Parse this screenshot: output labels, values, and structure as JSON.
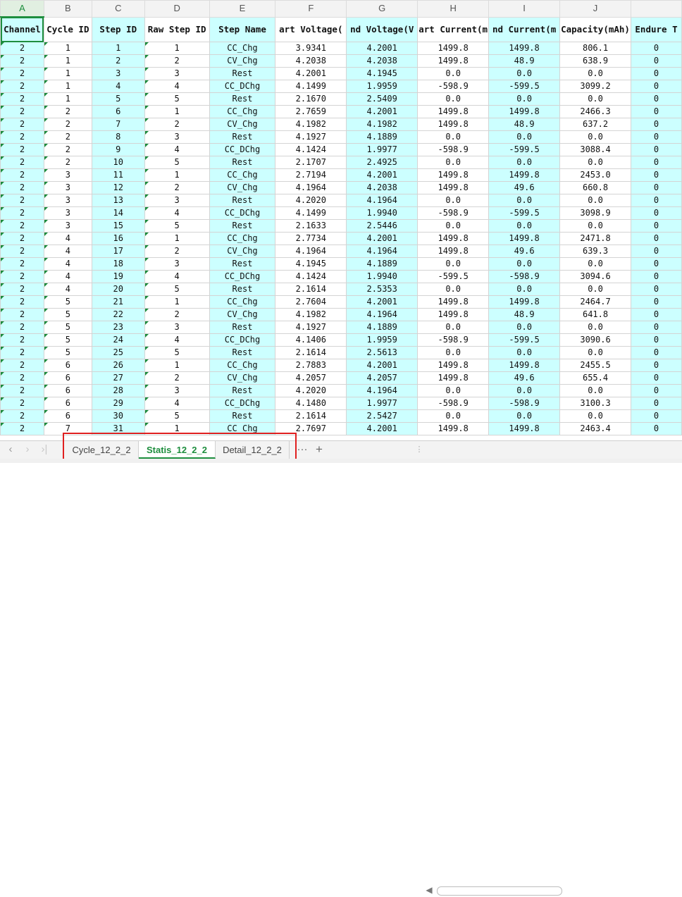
{
  "columns": [
    "A",
    "B",
    "C",
    "D",
    "E",
    "F",
    "G",
    "H",
    "I",
    "J",
    ""
  ],
  "headers": [
    "Channel",
    "Cycle ID",
    "Step ID",
    "Raw Step ID",
    "Step Name",
    "art Voltage(",
    "nd Voltage(V",
    "art Current(m",
    "nd Current(m",
    "Capacity(mAh)",
    "Endure T"
  ],
  "rows": [
    [
      "2",
      "1",
      "1",
      "1",
      "CC_Chg",
      "3.9341",
      "4.2001",
      "1499.8",
      "1499.8",
      "806.1",
      "0"
    ],
    [
      "2",
      "1",
      "2",
      "2",
      "CV_Chg",
      "4.2038",
      "4.2038",
      "1499.8",
      "48.9",
      "638.9",
      "0"
    ],
    [
      "2",
      "1",
      "3",
      "3",
      "Rest",
      "4.2001",
      "4.1945",
      "0.0",
      "0.0",
      "0.0",
      "0"
    ],
    [
      "2",
      "1",
      "4",
      "4",
      "CC_DChg",
      "4.1499",
      "1.9959",
      "-598.9",
      "-599.5",
      "3099.2",
      "0"
    ],
    [
      "2",
      "1",
      "5",
      "5",
      "Rest",
      "2.1670",
      "2.5409",
      "0.0",
      "0.0",
      "0.0",
      "0"
    ],
    [
      "2",
      "2",
      "6",
      "1",
      "CC_Chg",
      "2.7659",
      "4.2001",
      "1499.8",
      "1499.8",
      "2466.3",
      "0"
    ],
    [
      "2",
      "2",
      "7",
      "2",
      "CV_Chg",
      "4.1982",
      "4.1982",
      "1499.8",
      "48.9",
      "637.2",
      "0"
    ],
    [
      "2",
      "2",
      "8",
      "3",
      "Rest",
      "4.1927",
      "4.1889",
      "0.0",
      "0.0",
      "0.0",
      "0"
    ],
    [
      "2",
      "2",
      "9",
      "4",
      "CC_DChg",
      "4.1424",
      "1.9977",
      "-598.9",
      "-599.5",
      "3088.4",
      "0"
    ],
    [
      "2",
      "2",
      "10",
      "5",
      "Rest",
      "2.1707",
      "2.4925",
      "0.0",
      "0.0",
      "0.0",
      "0"
    ],
    [
      "2",
      "3",
      "11",
      "1",
      "CC_Chg",
      "2.7194",
      "4.2001",
      "1499.8",
      "1499.8",
      "2453.0",
      "0"
    ],
    [
      "2",
      "3",
      "12",
      "2",
      "CV_Chg",
      "4.1964",
      "4.2038",
      "1499.8",
      "49.6",
      "660.8",
      "0"
    ],
    [
      "2",
      "3",
      "13",
      "3",
      "Rest",
      "4.2020",
      "4.1964",
      "0.0",
      "0.0",
      "0.0",
      "0"
    ],
    [
      "2",
      "3",
      "14",
      "4",
      "CC_DChg",
      "4.1499",
      "1.9940",
      "-598.9",
      "-599.5",
      "3098.9",
      "0"
    ],
    [
      "2",
      "3",
      "15",
      "5",
      "Rest",
      "2.1633",
      "2.5446",
      "0.0",
      "0.0",
      "0.0",
      "0"
    ],
    [
      "2",
      "4",
      "16",
      "1",
      "CC_Chg",
      "2.7734",
      "4.2001",
      "1499.8",
      "1499.8",
      "2471.8",
      "0"
    ],
    [
      "2",
      "4",
      "17",
      "2",
      "CV_Chg",
      "4.1964",
      "4.1964",
      "1499.8",
      "49.6",
      "639.3",
      "0"
    ],
    [
      "2",
      "4",
      "18",
      "3",
      "Rest",
      "4.1945",
      "4.1889",
      "0.0",
      "0.0",
      "0.0",
      "0"
    ],
    [
      "2",
      "4",
      "19",
      "4",
      "CC_DChg",
      "4.1424",
      "1.9940",
      "-599.5",
      "-598.9",
      "3094.6",
      "0"
    ],
    [
      "2",
      "4",
      "20",
      "5",
      "Rest",
      "2.1614",
      "2.5353",
      "0.0",
      "0.0",
      "0.0",
      "0"
    ],
    [
      "2",
      "5",
      "21",
      "1",
      "CC_Chg",
      "2.7604",
      "4.2001",
      "1499.8",
      "1499.8",
      "2464.7",
      "0"
    ],
    [
      "2",
      "5",
      "22",
      "2",
      "CV_Chg",
      "4.1982",
      "4.1964",
      "1499.8",
      "48.9",
      "641.8",
      "0"
    ],
    [
      "2",
      "5",
      "23",
      "3",
      "Rest",
      "4.1927",
      "4.1889",
      "0.0",
      "0.0",
      "0.0",
      "0"
    ],
    [
      "2",
      "5",
      "24",
      "4",
      "CC_DChg",
      "4.1406",
      "1.9959",
      "-598.9",
      "-599.5",
      "3090.6",
      "0"
    ],
    [
      "2",
      "5",
      "25",
      "5",
      "Rest",
      "2.1614",
      "2.5613",
      "0.0",
      "0.0",
      "0.0",
      "0"
    ],
    [
      "2",
      "6",
      "26",
      "1",
      "CC_Chg",
      "2.7883",
      "4.2001",
      "1499.8",
      "1499.8",
      "2455.5",
      "0"
    ],
    [
      "2",
      "6",
      "27",
      "2",
      "CV_Chg",
      "4.2057",
      "4.2057",
      "1499.8",
      "49.6",
      "655.4",
      "0"
    ],
    [
      "2",
      "6",
      "28",
      "3",
      "Rest",
      "4.2020",
      "4.1964",
      "0.0",
      "0.0",
      "0.0",
      "0"
    ],
    [
      "2",
      "6",
      "29",
      "4",
      "CC_DChg",
      "4.1480",
      "1.9977",
      "-598.9",
      "-598.9",
      "3100.3",
      "0"
    ],
    [
      "2",
      "6",
      "30",
      "5",
      "Rest",
      "2.1614",
      "2.5427",
      "0.0",
      "0.0",
      "0.0",
      "0"
    ],
    [
      "2",
      "7",
      "31",
      "1",
      "CC_Chg",
      "2.7697",
      "4.2001",
      "1499.8",
      "1499.8",
      "2463.4",
      "0"
    ]
  ],
  "tabs": [
    "Cycle_12_2_2",
    "Statis_12_2_2",
    "Detail_12_2_2"
  ],
  "active_tab": 1,
  "more_tabs": "···",
  "add_tab": "+",
  "colors": {
    "accent": "#1e8e3e",
    "cyan_fill": "#ccffff",
    "highlight_box": "#e02020"
  }
}
